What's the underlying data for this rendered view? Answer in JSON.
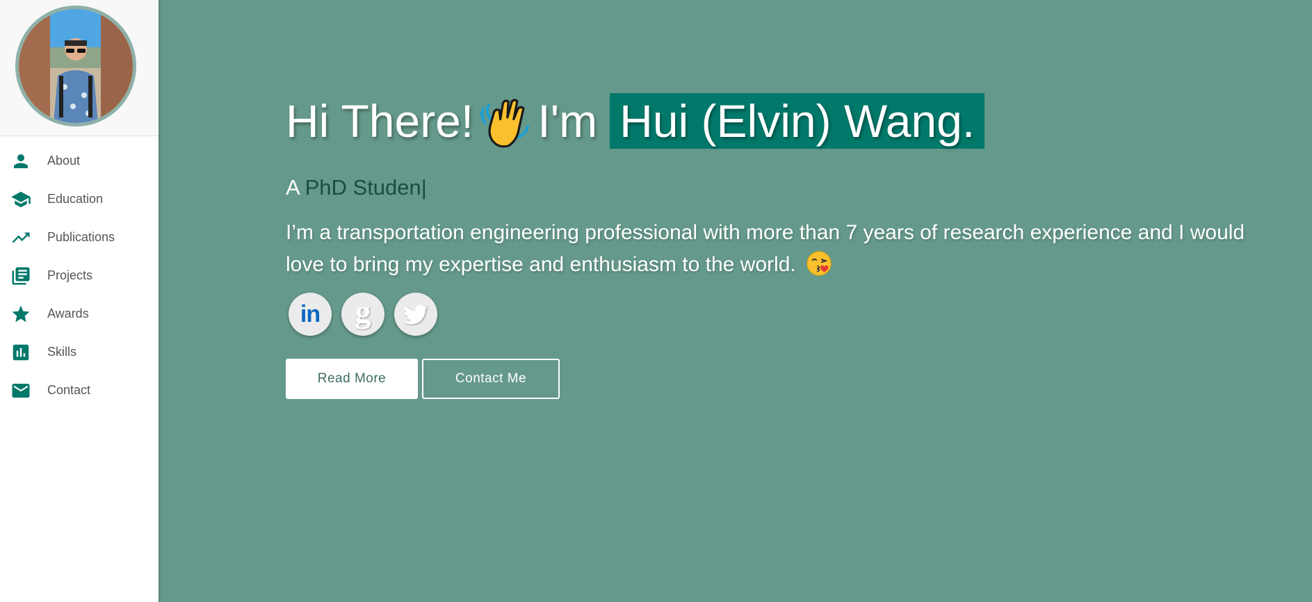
{
  "sidebar": {
    "items": [
      {
        "label": "About",
        "icon": "person-icon"
      },
      {
        "label": "Education",
        "icon": "graduation-cap-icon"
      },
      {
        "label": "Publications",
        "icon": "trending-up-icon"
      },
      {
        "label": "Projects",
        "icon": "library-books-icon"
      },
      {
        "label": "Awards",
        "icon": "star-icon"
      },
      {
        "label": "Skills",
        "icon": "bar-chart-icon"
      },
      {
        "label": "Contact",
        "icon": "mail-icon"
      }
    ]
  },
  "hero": {
    "greeting": "Hi There!",
    "intro": "I'm",
    "name": "Hui (Elvin) Wang.",
    "subtitle_prefix": "A",
    "subtitle_typed": "PhD Studen",
    "cursor": "|",
    "description": "I’m a transportation engineering professional with more than 7 years of research experience and I would love to bring my expertise and enthusiasm to the world.",
    "socials": [
      {
        "name": "LinkedIn",
        "glyph": "in"
      },
      {
        "name": "Google Scholar",
        "glyph": "g"
      },
      {
        "name": "Twitter",
        "glyph": "twitter-bird"
      }
    ],
    "read_more_label": "Read More",
    "contact_label": "Contact Me"
  },
  "colors": {
    "accent": "#00796b",
    "hero_background": "#65998b",
    "sidebar_background": "#ffffff",
    "nav_text": "#555555"
  }
}
